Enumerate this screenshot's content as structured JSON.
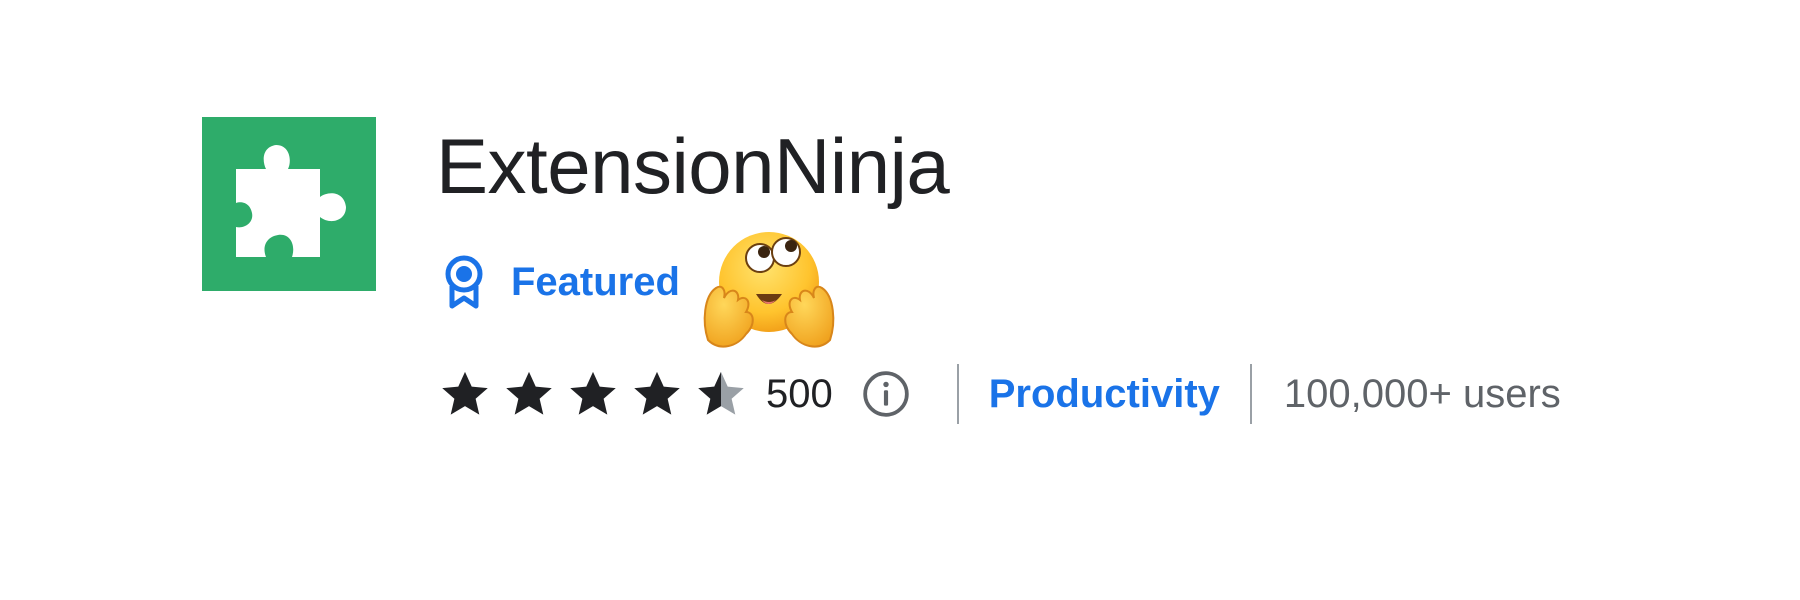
{
  "extension": {
    "name": "ExtensionNinja",
    "icon": "puzzle-piece-icon",
    "icon_bg_color": "#2eac6a"
  },
  "badge": {
    "label": "Featured",
    "icon": "award-badge-icon",
    "color": "#1a73e8"
  },
  "sticker": {
    "emoji": "face-with-rolling-eyes-holding-cheeks-emoji"
  },
  "rating": {
    "stars": 4.5,
    "max_stars": 5,
    "count": "500",
    "info_icon": "info-icon"
  },
  "category": {
    "label": "Productivity",
    "color": "#1a73e8"
  },
  "users": {
    "label": "100,000+ users"
  }
}
